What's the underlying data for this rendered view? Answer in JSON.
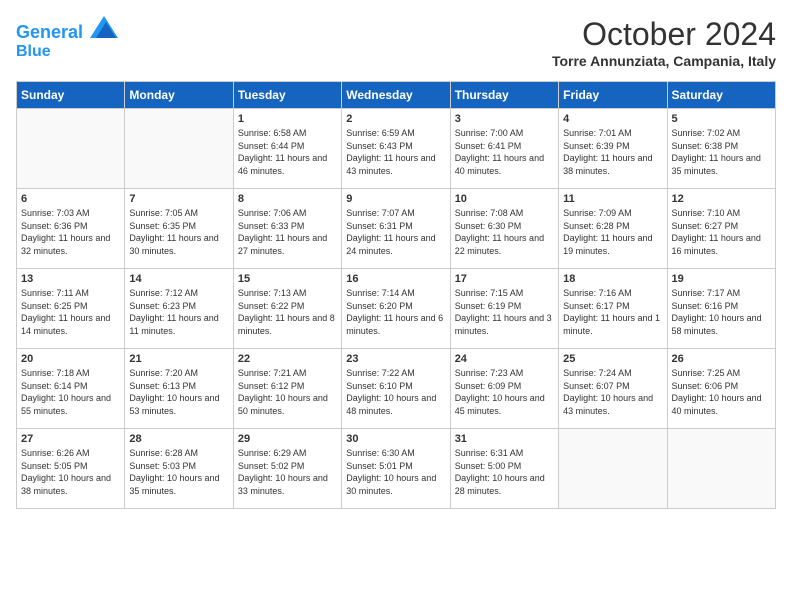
{
  "header": {
    "logo_line1": "General",
    "logo_line2": "Blue",
    "month": "October 2024",
    "location": "Torre Annunziata, Campania, Italy"
  },
  "weekdays": [
    "Sunday",
    "Monday",
    "Tuesday",
    "Wednesday",
    "Thursday",
    "Friday",
    "Saturday"
  ],
  "weeks": [
    [
      {
        "day": "",
        "text": ""
      },
      {
        "day": "",
        "text": ""
      },
      {
        "day": "1",
        "text": "Sunrise: 6:58 AM\nSunset: 6:44 PM\nDaylight: 11 hours and 46 minutes."
      },
      {
        "day": "2",
        "text": "Sunrise: 6:59 AM\nSunset: 6:43 PM\nDaylight: 11 hours and 43 minutes."
      },
      {
        "day": "3",
        "text": "Sunrise: 7:00 AM\nSunset: 6:41 PM\nDaylight: 11 hours and 40 minutes."
      },
      {
        "day": "4",
        "text": "Sunrise: 7:01 AM\nSunset: 6:39 PM\nDaylight: 11 hours and 38 minutes."
      },
      {
        "day": "5",
        "text": "Sunrise: 7:02 AM\nSunset: 6:38 PM\nDaylight: 11 hours and 35 minutes."
      }
    ],
    [
      {
        "day": "6",
        "text": "Sunrise: 7:03 AM\nSunset: 6:36 PM\nDaylight: 11 hours and 32 minutes."
      },
      {
        "day": "7",
        "text": "Sunrise: 7:05 AM\nSunset: 6:35 PM\nDaylight: 11 hours and 30 minutes."
      },
      {
        "day": "8",
        "text": "Sunrise: 7:06 AM\nSunset: 6:33 PM\nDaylight: 11 hours and 27 minutes."
      },
      {
        "day": "9",
        "text": "Sunrise: 7:07 AM\nSunset: 6:31 PM\nDaylight: 11 hours and 24 minutes."
      },
      {
        "day": "10",
        "text": "Sunrise: 7:08 AM\nSunset: 6:30 PM\nDaylight: 11 hours and 22 minutes."
      },
      {
        "day": "11",
        "text": "Sunrise: 7:09 AM\nSunset: 6:28 PM\nDaylight: 11 hours and 19 minutes."
      },
      {
        "day": "12",
        "text": "Sunrise: 7:10 AM\nSunset: 6:27 PM\nDaylight: 11 hours and 16 minutes."
      }
    ],
    [
      {
        "day": "13",
        "text": "Sunrise: 7:11 AM\nSunset: 6:25 PM\nDaylight: 11 hours and 14 minutes."
      },
      {
        "day": "14",
        "text": "Sunrise: 7:12 AM\nSunset: 6:23 PM\nDaylight: 11 hours and 11 minutes."
      },
      {
        "day": "15",
        "text": "Sunrise: 7:13 AM\nSunset: 6:22 PM\nDaylight: 11 hours and 8 minutes."
      },
      {
        "day": "16",
        "text": "Sunrise: 7:14 AM\nSunset: 6:20 PM\nDaylight: 11 hours and 6 minutes."
      },
      {
        "day": "17",
        "text": "Sunrise: 7:15 AM\nSunset: 6:19 PM\nDaylight: 11 hours and 3 minutes."
      },
      {
        "day": "18",
        "text": "Sunrise: 7:16 AM\nSunset: 6:17 PM\nDaylight: 11 hours and 1 minute."
      },
      {
        "day": "19",
        "text": "Sunrise: 7:17 AM\nSunset: 6:16 PM\nDaylight: 10 hours and 58 minutes."
      }
    ],
    [
      {
        "day": "20",
        "text": "Sunrise: 7:18 AM\nSunset: 6:14 PM\nDaylight: 10 hours and 55 minutes."
      },
      {
        "day": "21",
        "text": "Sunrise: 7:20 AM\nSunset: 6:13 PM\nDaylight: 10 hours and 53 minutes."
      },
      {
        "day": "22",
        "text": "Sunrise: 7:21 AM\nSunset: 6:12 PM\nDaylight: 10 hours and 50 minutes."
      },
      {
        "day": "23",
        "text": "Sunrise: 7:22 AM\nSunset: 6:10 PM\nDaylight: 10 hours and 48 minutes."
      },
      {
        "day": "24",
        "text": "Sunrise: 7:23 AM\nSunset: 6:09 PM\nDaylight: 10 hours and 45 minutes."
      },
      {
        "day": "25",
        "text": "Sunrise: 7:24 AM\nSunset: 6:07 PM\nDaylight: 10 hours and 43 minutes."
      },
      {
        "day": "26",
        "text": "Sunrise: 7:25 AM\nSunset: 6:06 PM\nDaylight: 10 hours and 40 minutes."
      }
    ],
    [
      {
        "day": "27",
        "text": "Sunrise: 6:26 AM\nSunset: 5:05 PM\nDaylight: 10 hours and 38 minutes."
      },
      {
        "day": "28",
        "text": "Sunrise: 6:28 AM\nSunset: 5:03 PM\nDaylight: 10 hours and 35 minutes."
      },
      {
        "day": "29",
        "text": "Sunrise: 6:29 AM\nSunset: 5:02 PM\nDaylight: 10 hours and 33 minutes."
      },
      {
        "day": "30",
        "text": "Sunrise: 6:30 AM\nSunset: 5:01 PM\nDaylight: 10 hours and 30 minutes."
      },
      {
        "day": "31",
        "text": "Sunrise: 6:31 AM\nSunset: 5:00 PM\nDaylight: 10 hours and 28 minutes."
      },
      {
        "day": "",
        "text": ""
      },
      {
        "day": "",
        "text": ""
      }
    ]
  ]
}
